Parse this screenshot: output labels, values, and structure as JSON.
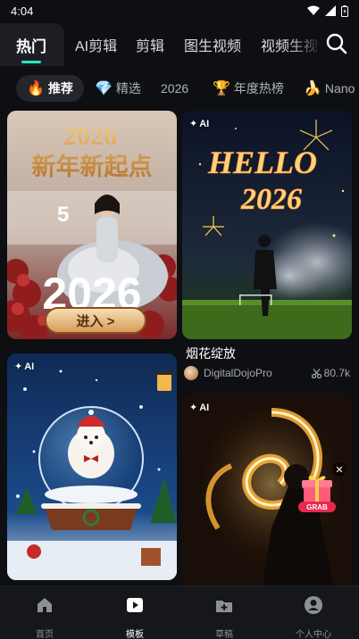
{
  "status_bar": {
    "time": "4:04"
  },
  "top_tabs": [
    {
      "label": "热门",
      "active": true
    },
    {
      "label": "AI剪辑"
    },
    {
      "label": "剪辑"
    },
    {
      "label": "图生视频"
    },
    {
      "label": "视频生视"
    }
  ],
  "filters": [
    {
      "emoji": "🔥",
      "label": "推荐",
      "active": true
    },
    {
      "emoji": "💎",
      "label": "精选"
    },
    {
      "emoji": "",
      "label": "2026"
    },
    {
      "emoji": "🏆",
      "label": "年度热榜"
    },
    {
      "emoji": "🍌",
      "label": "Nano"
    }
  ],
  "cards": {
    "new_year": {
      "headline": "2026\n新年新起点",
      "big_year": "2026",
      "enter_button": "进入 >",
      "side_num": "5"
    },
    "fireworks": {
      "badge": "AI",
      "text_line1": "HELLO",
      "text_line2": "2026",
      "title": "烟花绽放",
      "author": "DigitalDojoPro",
      "uses": "80.7k"
    },
    "snow_globe": {
      "badge": "AI"
    },
    "fire": {
      "badge": "AI",
      "grab_label": "GRAB"
    }
  },
  "bottom_nav": [
    {
      "label": "首页",
      "icon": "home-icon"
    },
    {
      "label": "模板",
      "icon": "template-icon",
      "active": true
    },
    {
      "label": "草稿",
      "icon": "drafts-icon"
    },
    {
      "label": "个人中心",
      "icon": "profile-icon"
    }
  ],
  "colors": {
    "accent": "#2ee6c5",
    "background": "#0e0f12"
  }
}
